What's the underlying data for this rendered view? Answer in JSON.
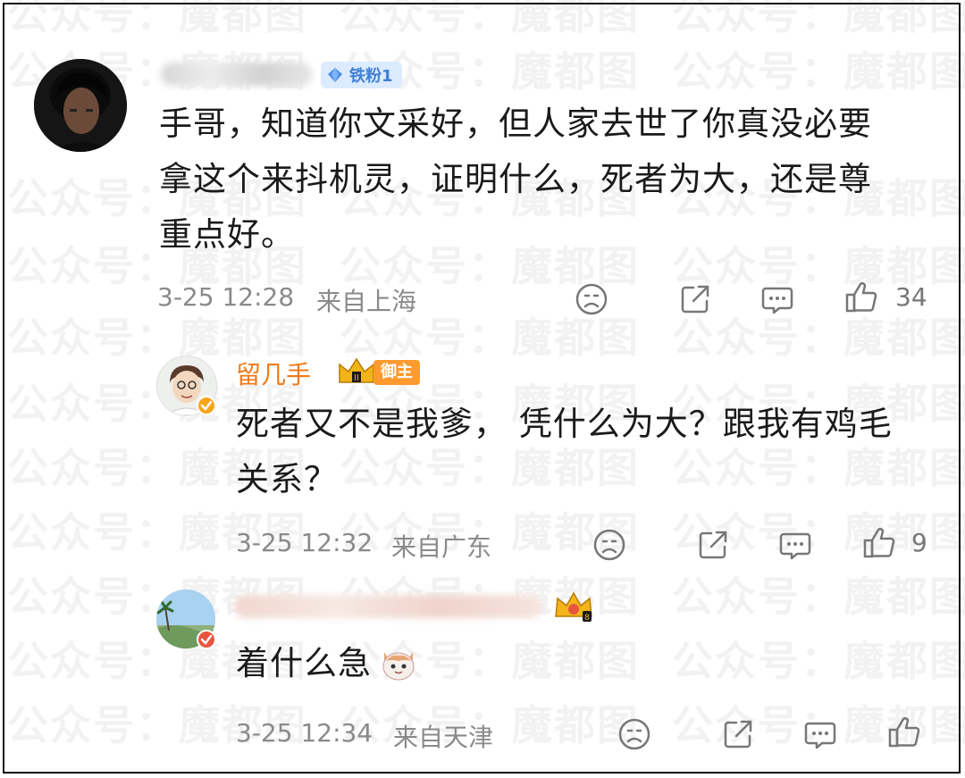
{
  "watermark": {
    "text": "公众号：魔都图"
  },
  "comments": [
    {
      "badge": "铁粉1",
      "text": "手哥，知道你文采好，但人家去世了你真没必要拿这个来抖机灵，证明什么，死者为大，还是尊重点好。",
      "lines": [
        "手哥，知道你文采好，但人家去世了你真没必要",
        "拿这个来抖机灵，证明什么，死者为大，还是尊",
        "重点好。"
      ],
      "timestamp": "3-25 12:28",
      "location": "来自上海",
      "likes": "34"
    },
    {
      "username": "留几手",
      "tag": "御主",
      "lines": [
        "死者又不是我爹， 凭什么为大？跟我有鸡毛",
        "关系？"
      ],
      "timestamp": "3-25 12:32",
      "location": "来自广东",
      "likes": "9"
    },
    {
      "lines": [
        "着什么急"
      ],
      "emoji": "cat-emoji",
      "timestamp": "3-25 12:34",
      "location": "来自天津",
      "likes": ""
    }
  ],
  "icons": [
    "dislike-icon",
    "share-icon",
    "comment-icon",
    "like-icon"
  ],
  "colors": {
    "accent": "#f07a1a",
    "meta": "#8a8a8a",
    "fan_badge": "#dcebff",
    "vip": "#ff9a2e"
  }
}
